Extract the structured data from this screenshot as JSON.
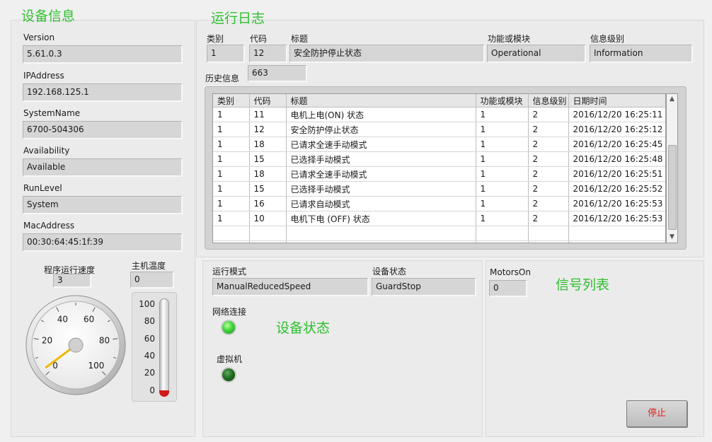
{
  "device_info": {
    "title": "设备信息",
    "fields": [
      {
        "label": "Version",
        "value": "5.61.0.3"
      },
      {
        "label": "IPAddress",
        "value": "192.168.125.1"
      },
      {
        "label": "SystemName",
        "value": "6700-504306"
      },
      {
        "label": "Availability",
        "value": "Available"
      },
      {
        "label": "RunLevel",
        "value": "System"
      },
      {
        "label": "MacAddress",
        "value": "00:30:64:45:1f:39"
      }
    ],
    "speed": {
      "label": "程序运行速度",
      "value": "3",
      "gauge_value": 3,
      "gauge_min": 0,
      "gauge_max": 100,
      "ticks": [
        "0",
        "20",
        "40",
        "60",
        "80",
        "100"
      ]
    },
    "temp": {
      "label": "主机温度",
      "value": "0",
      "level": 0,
      "ticks": [
        "100",
        "80",
        "60",
        "40",
        "20",
        "0"
      ]
    }
  },
  "log": {
    "title": "运行日志",
    "current": {
      "category_label": "类别",
      "category": "1",
      "code_label": "代码",
      "code": "12",
      "title_label": "标题",
      "title": "安全防护停止状态",
      "module_label": "功能或模块",
      "module": "Operational",
      "level_label": "信息级别",
      "level": "Information"
    },
    "history_label": "历史信息",
    "history_count": "663",
    "columns": [
      "类别",
      "代码",
      "标题",
      "功能或模块",
      "信息级别",
      "日期时间"
    ],
    "rows": [
      [
        "1",
        "11",
        "电机上电(ON) 状态",
        "1",
        "2",
        "2016/12/20 16:25:11"
      ],
      [
        "1",
        "12",
        "安全防护停止状态",
        "1",
        "2",
        "2016/12/20 16:25:12"
      ],
      [
        "1",
        "18",
        "已请求全速手动模式",
        "1",
        "2",
        "2016/12/20 16:25:45"
      ],
      [
        "1",
        "15",
        "已选择手动模式",
        "1",
        "2",
        "2016/12/20 16:25:48"
      ],
      [
        "1",
        "18",
        "已请求全速手动模式",
        "1",
        "2",
        "2016/12/20 16:25:51"
      ],
      [
        "1",
        "15",
        "已选择手动模式",
        "1",
        "2",
        "2016/12/20 16:25:52"
      ],
      [
        "1",
        "16",
        "已请求自动模式",
        "1",
        "2",
        "2016/12/20 16:25:53"
      ],
      [
        "1",
        "10",
        "电机下电 (OFF) 状态",
        "1",
        "2",
        "2016/12/20 16:25:53"
      ]
    ]
  },
  "device_status": {
    "title": "设备状态",
    "mode_label": "运行模式",
    "mode": "ManualReducedSpeed",
    "state_label": "设备状态",
    "state": "GuardStop",
    "network_label": "网络连接",
    "network_on": true,
    "virtual_label": "虚拟机",
    "virtual_on": false
  },
  "signals": {
    "title": "信号列表",
    "motors_label": "MotorsOn",
    "motors_value": "0"
  },
  "stop_button": "停止",
  "colors": {
    "accent_title": "#2fbf2f",
    "stop_text": "#e02020",
    "led_on": "#3fd73a",
    "led_off": "#1f6a1f",
    "thermo_fill": "#d11a1a"
  }
}
